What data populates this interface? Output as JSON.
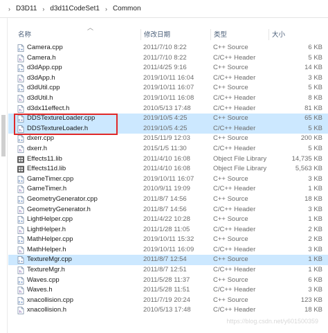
{
  "breadcrumb": [
    "D3D11",
    "d3d11CodeSet1",
    "Common"
  ],
  "columns": {
    "name": "名称",
    "date": "修改日期",
    "type": "类型",
    "size": "大小"
  },
  "files": [
    {
      "name": "Camera.cpp",
      "date": "2011/7/10 8:22",
      "type": "C++ Source",
      "size": "6 KB",
      "kind": "cpp"
    },
    {
      "name": "Camera.h",
      "date": "2011/7/10 8:22",
      "type": "C/C++ Header",
      "size": "5 KB",
      "kind": "h"
    },
    {
      "name": "d3dApp.cpp",
      "date": "2011/4/25 9:16",
      "type": "C++ Source",
      "size": "14 KB",
      "kind": "cpp"
    },
    {
      "name": "d3dApp.h",
      "date": "2019/10/11 16:04",
      "type": "C/C++ Header",
      "size": "3 KB",
      "kind": "h"
    },
    {
      "name": "d3dUtil.cpp",
      "date": "2019/10/11 16:07",
      "type": "C++ Source",
      "size": "5 KB",
      "kind": "cpp"
    },
    {
      "name": "d3dUtil.h",
      "date": "2019/10/11 16:08",
      "type": "C/C++ Header",
      "size": "8 KB",
      "kind": "h"
    },
    {
      "name": "d3dx11effect.h",
      "date": "2010/5/13 17:48",
      "type": "C/C++ Header",
      "size": "81 KB",
      "kind": "h"
    },
    {
      "name": "DDSTextureLoader.cpp",
      "date": "2019/10/5 4:25",
      "type": "C++ Source",
      "size": "65 KB",
      "kind": "cpp",
      "selected": true
    },
    {
      "name": "DDSTextureLoader.h",
      "date": "2019/10/5 4:25",
      "type": "C/C++ Header",
      "size": "5 KB",
      "kind": "h",
      "selected": true
    },
    {
      "name": "dxerr.cpp",
      "date": "2015/11/9 12:03",
      "type": "C++ Source",
      "size": "200 KB",
      "kind": "cpp"
    },
    {
      "name": "dxerr.h",
      "date": "2015/1/5 11:30",
      "type": "C/C++ Header",
      "size": "5 KB",
      "kind": "h"
    },
    {
      "name": "Effects11.lib",
      "date": "2011/4/10 16:08",
      "type": "Object File Library",
      "size": "14,735 KB",
      "kind": "lib"
    },
    {
      "name": "Effects11d.lib",
      "date": "2011/4/10 16:08",
      "type": "Object File Library",
      "size": "5,563 KB",
      "kind": "lib"
    },
    {
      "name": "GameTimer.cpp",
      "date": "2019/10/11 16:07",
      "type": "C++ Source",
      "size": "3 KB",
      "kind": "cpp"
    },
    {
      "name": "GameTimer.h",
      "date": "2010/9/11 19:09",
      "type": "C/C++ Header",
      "size": "1 KB",
      "kind": "h"
    },
    {
      "name": "GeometryGenerator.cpp",
      "date": "2011/8/7 14:56",
      "type": "C++ Source",
      "size": "18 KB",
      "kind": "cpp"
    },
    {
      "name": "GeometryGenerator.h",
      "date": "2011/8/7 14:56",
      "type": "C/C++ Header",
      "size": "3 KB",
      "kind": "h"
    },
    {
      "name": "LightHelper.cpp",
      "date": "2011/4/22 10:28",
      "type": "C++ Source",
      "size": "1 KB",
      "kind": "cpp"
    },
    {
      "name": "LightHelper.h",
      "date": "2011/1/28 11:05",
      "type": "C/C++ Header",
      "size": "2 KB",
      "kind": "h"
    },
    {
      "name": "MathHelper.cpp",
      "date": "2019/10/11 15:32",
      "type": "C++ Source",
      "size": "2 KB",
      "kind": "cpp"
    },
    {
      "name": "MathHelper.h",
      "date": "2019/10/11 16:09",
      "type": "C/C++ Header",
      "size": "3 KB",
      "kind": "h"
    },
    {
      "name": "TextureMgr.cpp",
      "date": "2011/8/7 12:54",
      "type": "C++ Source",
      "size": "1 KB",
      "kind": "cpp",
      "hover": true
    },
    {
      "name": "TextureMgr.h",
      "date": "2011/8/7 12:51",
      "type": "C/C++ Header",
      "size": "1 KB",
      "kind": "h"
    },
    {
      "name": "Waves.cpp",
      "date": "2011/5/28 11:37",
      "type": "C++ Source",
      "size": "6 KB",
      "kind": "cpp"
    },
    {
      "name": "Waves.h",
      "date": "2011/5/28 11:51",
      "type": "C/C++ Header",
      "size": "3 KB",
      "kind": "h"
    },
    {
      "name": "xnacollision.cpp",
      "date": "2011/7/19 20:24",
      "type": "C++ Source",
      "size": "123 KB",
      "kind": "cpp"
    },
    {
      "name": "xnacollision.h",
      "date": "2010/5/13 17:48",
      "type": "C/C++ Header",
      "size": "18 KB",
      "kind": "h"
    }
  ],
  "watermark": "https://blog.csdn.net/y601500359"
}
